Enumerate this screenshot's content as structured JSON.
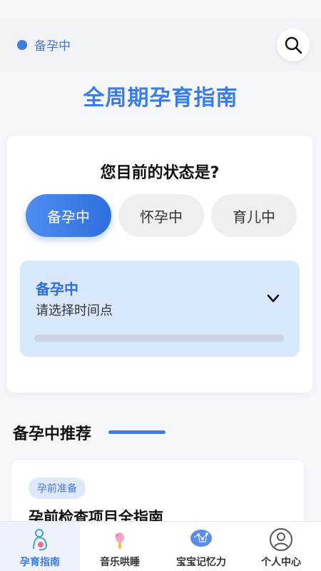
{
  "header": {
    "status_label": "备孕中",
    "search_icon": "search-icon"
  },
  "page_title": "全周期孕育指南",
  "state_card": {
    "question": "您目前的状态是?",
    "options": [
      {
        "label": "备孕中",
        "selected": true
      },
      {
        "label": "怀孕中",
        "selected": false
      },
      {
        "label": "育儿中",
        "selected": false
      }
    ],
    "stage": {
      "name": "备孕中",
      "hint": "请选择时间点",
      "icon": "chevron-down-icon"
    }
  },
  "recommend": {
    "title": "备孕中推荐",
    "card": {
      "tag": "孕前准备",
      "title": "孕前检查项目全指南"
    }
  },
  "tabbar": {
    "tabs": [
      {
        "label": "孕育指南",
        "icon": "mother-baby-icon",
        "active": true
      },
      {
        "label": "音乐哄睡",
        "icon": "music-icon",
        "active": false
      },
      {
        "label": "宝宝记忆力",
        "icon": "brain-icon",
        "active": false
      },
      {
        "label": "个人中心",
        "icon": "user-icon",
        "active": false
      }
    ]
  },
  "colors": {
    "accent": "#3b7de2",
    "stage_bg": "#d9e7fb"
  }
}
